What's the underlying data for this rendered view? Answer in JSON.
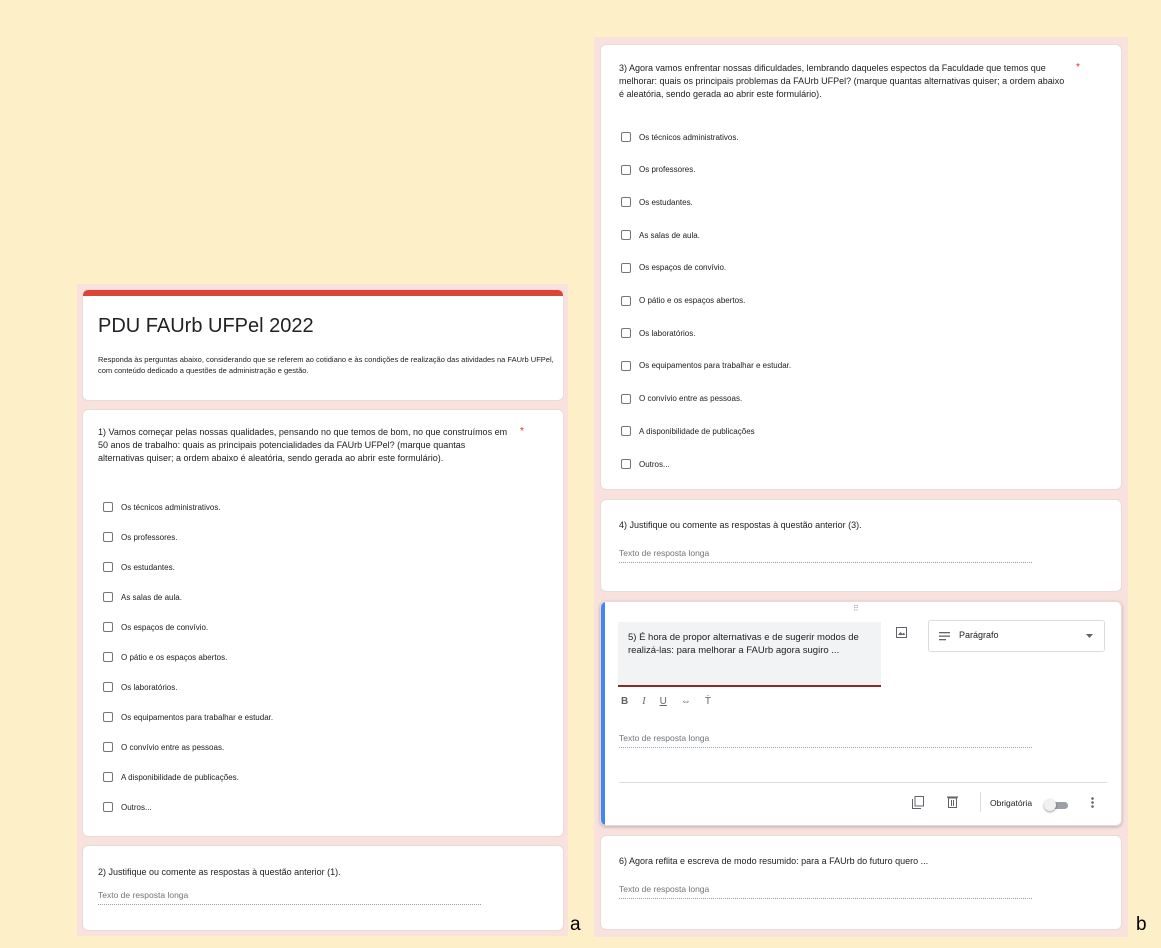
{
  "labels": {
    "a": "a",
    "b": "b"
  },
  "form": {
    "title": "PDU FAUrb UFPel 2022",
    "description": "Responda às perguntas abaixo, considerando que se referem ao cotidiano e às condições de realização das atividades na FAUrb UFPel,  com conteúdo dedicado a questões de administração e gestão."
  },
  "required_mark": "*",
  "q1": {
    "text": "1) Vamos começar pelas nossas qualidades, pensando no que temos de bom, no que construímos em 50 anos de trabalho: quais as principais potencialidades da FAUrb UFPel?  (marque quantas alternativas quiser; a ordem abaixo é aleatória, sendo gerada ao abrir este formulário).",
    "options": [
      "Os técnicos administrativos.",
      "Os professores.",
      "Os estudantes.",
      "As salas de aula.",
      "Os espaços de convívio.",
      "O pátio e os espaços abertos.",
      "Os laboratórios.",
      "Os equipamentos para trabalhar e estudar.",
      "O convívio entre as pessoas.",
      "A disponibilidade de publicações.",
      "Outros..."
    ]
  },
  "q2": {
    "text": "2) Justifique ou comente as respostas à questão anterior (1).",
    "placeholder": "Texto de resposta longa"
  },
  "q3": {
    "text": "3) Agora vamos enfrentar nossas dificuldades, lembrando daqueles espectos da Faculdade que temos que melhorar: quais os principais problemas da FAUrb UFPel? (marque quantas alternativas quiser; a ordem abaixo é aleatória, sendo gerada ao abrir este formulário).",
    "options": [
      "Os técnicos administrativos.",
      "Os professores.",
      "Os estudantes.",
      "As salas de aula.",
      "Os espaços de convívio.",
      "O pátio e os espaços abertos.",
      "Os laboratórios.",
      "Os equipamentos para trabalhar e estudar.",
      "O convívio entre as pessoas.",
      "A disponibilidade de publicações",
      "Outros..."
    ]
  },
  "q4": {
    "text": "4) Justifique ou comente as respostas à questão anterior (3).",
    "placeholder": "Texto de resposta longa"
  },
  "q5": {
    "text": "5)  É hora de propor  alternativas e de sugerir modos de realizá-las: para melhorar a FAUrb agora sugiro ...",
    "type_label": "Parágrafo",
    "placeholder": "Texto de resposta longa",
    "required_label": "Obrigatória",
    "drag_handle": "⠿",
    "icons": {
      "image": "image-icon",
      "paragraph": "paragraph-icon",
      "dropdown": "chevron-down-icon",
      "copy": "copy-icon",
      "delete": "trash-icon",
      "more": "more-vert-icon"
    },
    "format": {
      "bold": "B",
      "italic": "I",
      "underline": "U",
      "link": "⇔",
      "clear": "Ṫ"
    }
  },
  "q6": {
    "text": "6) Agora reflita e escreva de modo resumido: para a FAUrb do futuro quero ...",
    "placeholder": "Texto de resposta longa"
  },
  "colors": {
    "accent_red": "#db4437",
    "accent_blue": "#4285f4",
    "background": "#fdf0c9",
    "panel": "#f9e1de"
  }
}
